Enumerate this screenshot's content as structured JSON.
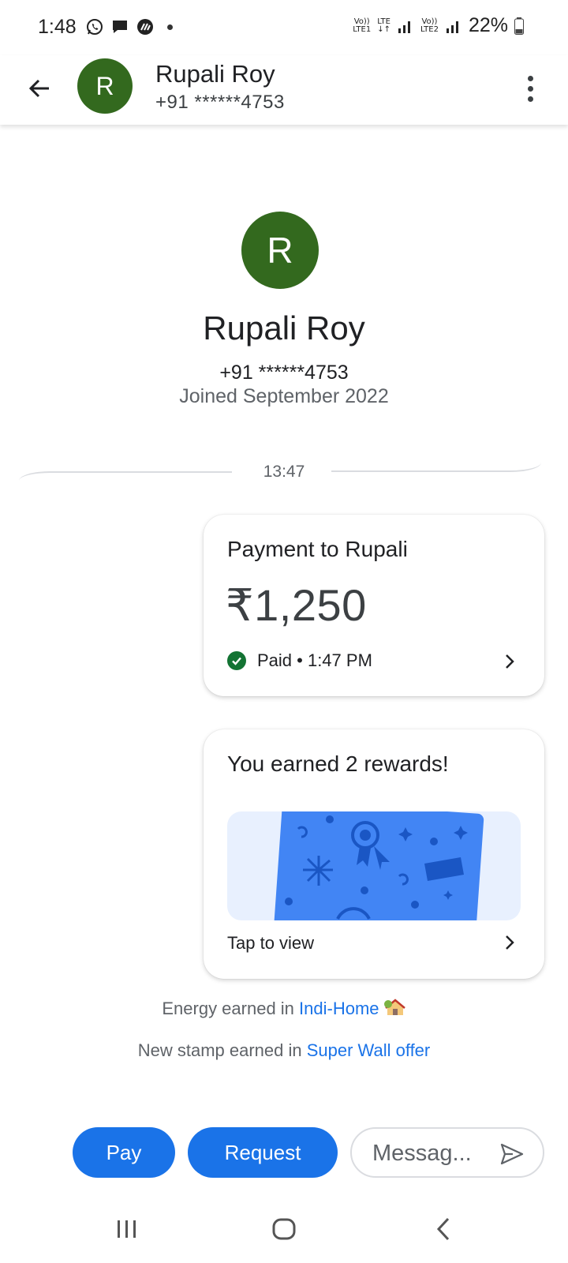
{
  "status_bar": {
    "time": "1:48",
    "battery": "22%",
    "sim1_top": "Vo))",
    "sim1_bottom": "LTE1",
    "lte_top": "LTE",
    "lte_bottom": "↓↑",
    "sim2_top": "Vo))",
    "sim2_bottom": "LTE2"
  },
  "header": {
    "avatar_letter": "R",
    "name": "Rupali Roy",
    "phone": "+91 ******4753"
  },
  "profile": {
    "avatar_letter": "R",
    "name": "Rupali Roy",
    "phone": "+91 ******4753",
    "joined": "Joined September 2022"
  },
  "chat": {
    "divider_time": "13:47",
    "payment_card": {
      "title": "Payment to Rupali",
      "amount": "₹1,250",
      "status": "Paid • 1:47 PM"
    },
    "reward_card": {
      "title": "You earned 2 rewards!",
      "action": "Tap to view"
    },
    "earnings": [
      {
        "prefix": "Energy earned in ",
        "link": "Indi-Home"
      },
      {
        "prefix": "New stamp earned in ",
        "link": "Super Wall offer"
      }
    ]
  },
  "bottom_bar": {
    "pay_label": "Pay",
    "request_label": "Request",
    "message_placeholder": "Messag..."
  },
  "colors": {
    "avatar": "#33691e",
    "primary": "#1a73e8",
    "paid_check": "#137333",
    "reward_card": "#4285f4"
  }
}
